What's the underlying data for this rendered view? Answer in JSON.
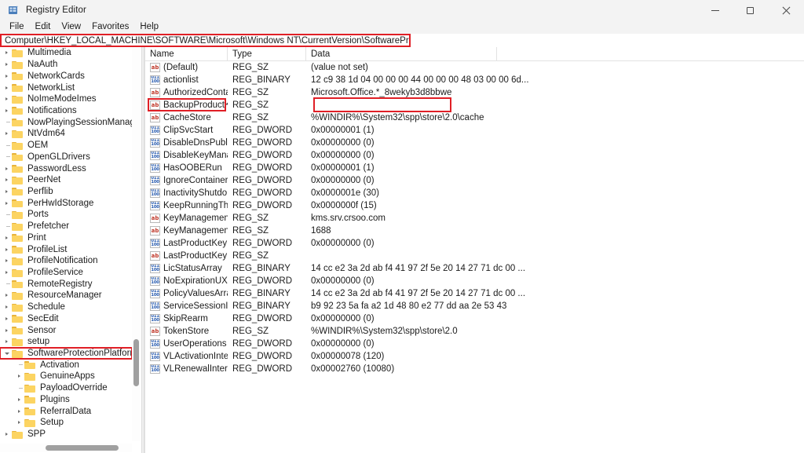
{
  "window": {
    "title": "Registry Editor",
    "icon": "registry-editor-icon",
    "controls": {
      "minimize": "−",
      "maximize": "□",
      "close": "✕"
    }
  },
  "menu": {
    "items": [
      "File",
      "Edit",
      "View",
      "Favorites",
      "Help"
    ]
  },
  "address": {
    "path": "Computer\\HKEY_LOCAL_MACHINE\\SOFTWARE\\Microsoft\\Windows NT\\CurrentVersion\\SoftwareProtectionPlatform",
    "highlight_color": "#e01f26"
  },
  "tree": {
    "items": [
      {
        "label": "Multimedia",
        "indent": 0,
        "state": "collapsed",
        "selected": false
      },
      {
        "label": "NaAuth",
        "indent": 0,
        "state": "collapsed",
        "selected": false
      },
      {
        "label": "NetworkCards",
        "indent": 0,
        "state": "collapsed",
        "selected": false
      },
      {
        "label": "NetworkList",
        "indent": 0,
        "state": "collapsed",
        "selected": false
      },
      {
        "label": "NoImeModeImes",
        "indent": 0,
        "state": "collapsed",
        "selected": false
      },
      {
        "label": "Notifications",
        "indent": 0,
        "state": "collapsed",
        "selected": false
      },
      {
        "label": "NowPlayingSessionManager",
        "indent": 0,
        "state": "leaf",
        "selected": false
      },
      {
        "label": "NtVdm64",
        "indent": 0,
        "state": "collapsed",
        "selected": false
      },
      {
        "label": "OEM",
        "indent": 0,
        "state": "leaf",
        "selected": false
      },
      {
        "label": "OpenGLDrivers",
        "indent": 0,
        "state": "leaf",
        "selected": false
      },
      {
        "label": "PasswordLess",
        "indent": 0,
        "state": "collapsed",
        "selected": false
      },
      {
        "label": "PeerNet",
        "indent": 0,
        "state": "collapsed",
        "selected": false
      },
      {
        "label": "Perflib",
        "indent": 0,
        "state": "collapsed",
        "selected": false
      },
      {
        "label": "PerHwIdStorage",
        "indent": 0,
        "state": "collapsed",
        "selected": false
      },
      {
        "label": "Ports",
        "indent": 0,
        "state": "leaf",
        "selected": false
      },
      {
        "label": "Prefetcher",
        "indent": 0,
        "state": "leaf",
        "selected": false
      },
      {
        "label": "Print",
        "indent": 0,
        "state": "collapsed",
        "selected": false
      },
      {
        "label": "ProfileList",
        "indent": 0,
        "state": "collapsed",
        "selected": false
      },
      {
        "label": "ProfileNotification",
        "indent": 0,
        "state": "collapsed",
        "selected": false
      },
      {
        "label": "ProfileService",
        "indent": 0,
        "state": "collapsed",
        "selected": false
      },
      {
        "label": "RemoteRegistry",
        "indent": 0,
        "state": "leaf",
        "selected": false
      },
      {
        "label": "ResourceManager",
        "indent": 0,
        "state": "collapsed",
        "selected": false
      },
      {
        "label": "Schedule",
        "indent": 0,
        "state": "collapsed",
        "selected": false
      },
      {
        "label": "SecEdit",
        "indent": 0,
        "state": "collapsed",
        "selected": false
      },
      {
        "label": "Sensor",
        "indent": 0,
        "state": "collapsed",
        "selected": false
      },
      {
        "label": "setup",
        "indent": 0,
        "state": "collapsed",
        "selected": false
      },
      {
        "label": "SoftwareProtectionPlatform",
        "indent": 0,
        "state": "expanded",
        "selected": true
      },
      {
        "label": "Activation",
        "indent": 1,
        "state": "leaf",
        "selected": false
      },
      {
        "label": "GenuineApps",
        "indent": 1,
        "state": "collapsed",
        "selected": false
      },
      {
        "label": "PayloadOverride",
        "indent": 1,
        "state": "leaf",
        "selected": false
      },
      {
        "label": "Plugins",
        "indent": 1,
        "state": "collapsed",
        "selected": false
      },
      {
        "label": "ReferralData",
        "indent": 1,
        "state": "collapsed",
        "selected": false
      },
      {
        "label": "Setup",
        "indent": 1,
        "state": "collapsed",
        "selected": false
      },
      {
        "label": "SPP",
        "indent": 0,
        "state": "collapsed",
        "selected": false
      }
    ]
  },
  "list": {
    "columns": [
      "Name",
      "Type",
      "Data"
    ],
    "rows": [
      {
        "name": "(Default)",
        "type": "REG_SZ",
        "data": "(value not set)",
        "icon": "string-value-icon"
      },
      {
        "name": "actionlist",
        "type": "REG_BINARY",
        "data": "12 c9 38 1d 04 00 00 00 44 00 00 00 48 03 00 00 6d...",
        "icon": "binary-value-icon"
      },
      {
        "name": "AuthorizedConta...",
        "type": "REG_SZ",
        "data": "Microsoft.Office.*_8wekyb3d8bbwe",
        "icon": "string-value-icon"
      },
      {
        "name": "BackupProductK...",
        "type": "REG_SZ",
        "data": "",
        "icon": "string-value-icon",
        "highlight": true
      },
      {
        "name": "CacheStore",
        "type": "REG_SZ",
        "data": "%WINDIR%\\System32\\spp\\store\\2.0\\cache",
        "icon": "string-value-icon"
      },
      {
        "name": "ClipSvcStart",
        "type": "REG_DWORD",
        "data": "0x00000001 (1)",
        "icon": "dword-value-icon"
      },
      {
        "name": "DisableDnsPubli...",
        "type": "REG_DWORD",
        "data": "0x00000000 (0)",
        "icon": "dword-value-icon"
      },
      {
        "name": "DisableKeyMana...",
        "type": "REG_DWORD",
        "data": "0x00000000 (0)",
        "icon": "dword-value-icon"
      },
      {
        "name": "HasOOBERun",
        "type": "REG_DWORD",
        "data": "0x00000001 (1)",
        "icon": "dword-value-icon"
      },
      {
        "name": "IgnoreContainer...",
        "type": "REG_DWORD",
        "data": "0x00000000 (0)",
        "icon": "dword-value-icon"
      },
      {
        "name": "InactivityShutdo...",
        "type": "REG_DWORD",
        "data": "0x0000001e (30)",
        "icon": "dword-value-icon"
      },
      {
        "name": "KeepRunningThr...",
        "type": "REG_DWORD",
        "data": "0x0000000f (15)",
        "icon": "dword-value-icon"
      },
      {
        "name": "KeyManagement...",
        "type": "REG_SZ",
        "data": "kms.srv.crsoo.com",
        "icon": "string-value-icon"
      },
      {
        "name": "KeyManagement...",
        "type": "REG_SZ",
        "data": "1688",
        "icon": "string-value-icon"
      },
      {
        "name": "LastProductKeyE...",
        "type": "REG_DWORD",
        "data": "0x00000000 (0)",
        "icon": "dword-value-icon"
      },
      {
        "name": "LastProductKeyPid",
        "type": "REG_SZ",
        "data": "",
        "icon": "string-value-icon"
      },
      {
        "name": "LicStatusArray",
        "type": "REG_BINARY",
        "data": "14 cc e2 3a 2d ab f4 41 97 2f 5e 20 14 27 71 dc 00 ...",
        "icon": "binary-value-icon"
      },
      {
        "name": "NoExpirationUX",
        "type": "REG_DWORD",
        "data": "0x00000000 (0)",
        "icon": "dword-value-icon"
      },
      {
        "name": "PolicyValuesArray",
        "type": "REG_BINARY",
        "data": "14 cc e2 3a 2d ab f4 41 97 2f 5e 20 14 27 71 dc 00 ...",
        "icon": "binary-value-icon"
      },
      {
        "name": "ServiceSessionId",
        "type": "REG_BINARY",
        "data": "b9 92 23 5a fa a2 1d 48 80 e2 77 dd aa 2e 53 43",
        "icon": "binary-value-icon"
      },
      {
        "name": "SkipRearm",
        "type": "REG_DWORD",
        "data": "0x00000000 (0)",
        "icon": "dword-value-icon"
      },
      {
        "name": "TokenStore",
        "type": "REG_SZ",
        "data": "%WINDIR%\\System32\\spp\\store\\2.0",
        "icon": "string-value-icon"
      },
      {
        "name": "UserOperations",
        "type": "REG_DWORD",
        "data": "0x00000000 (0)",
        "icon": "dword-value-icon"
      },
      {
        "name": "VLActivationInter...",
        "type": "REG_DWORD",
        "data": "0x00000078 (120)",
        "icon": "dword-value-icon"
      },
      {
        "name": "VLRenewalInterval",
        "type": "REG_DWORD",
        "data": "0x00002760 (10080)",
        "icon": "dword-value-icon"
      }
    ]
  }
}
